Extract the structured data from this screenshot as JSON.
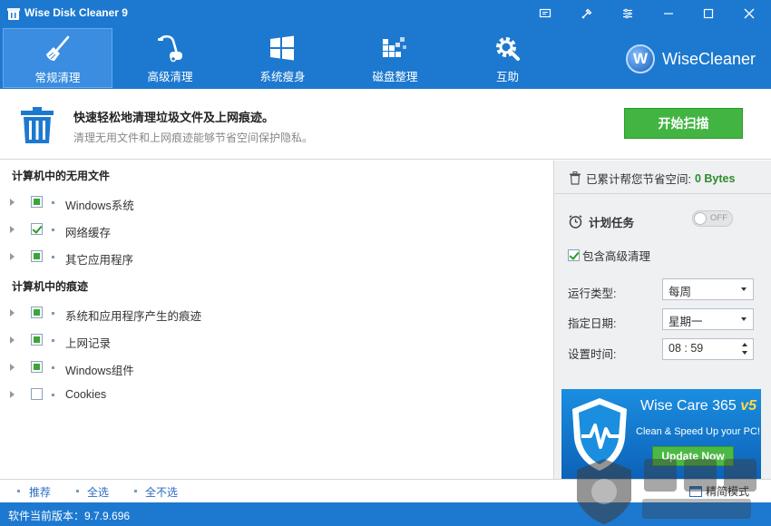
{
  "app": {
    "title": "Wise Disk Cleaner 9"
  },
  "window_controls": [
    "message-icon",
    "skin-icon",
    "menu-icon",
    "minimize-icon",
    "maximize-icon",
    "close-icon"
  ],
  "nav": {
    "items": [
      {
        "label": "常规清理",
        "icon": "broom-icon",
        "active": true
      },
      {
        "label": "高级清理",
        "icon": "vacuum-icon",
        "active": false
      },
      {
        "label": "系统瘦身",
        "icon": "windows-icon",
        "active": false
      },
      {
        "label": "磁盘整理",
        "icon": "defrag-icon",
        "active": false
      },
      {
        "label": "互助",
        "icon": "gear-wrench-icon",
        "active": false
      }
    ],
    "brand": "WiseCleaner",
    "brand_letter": "W"
  },
  "info": {
    "title": "快速轻松地清理垃圾文件及上网痕迹。",
    "subtitle": "清理无用文件和上网痕迹能够节省空间保护隐私。",
    "scan_button": "开始扫描"
  },
  "groups": [
    {
      "title": "计算机中的无用文件",
      "items": [
        {
          "label": "Windows系统",
          "state": "partial"
        },
        {
          "label": "网络缓存",
          "state": "checked"
        },
        {
          "label": "其它应用程序",
          "state": "partial"
        }
      ]
    },
    {
      "title": "计算机中的痕迹",
      "items": [
        {
          "label": "系统和应用程序产生的痕迹",
          "state": "partial"
        },
        {
          "label": "上网记录",
          "state": "partial"
        },
        {
          "label": "Windows组件",
          "state": "partial"
        },
        {
          "label": "Cookies",
          "state": "unchecked"
        }
      ]
    }
  ],
  "footer": {
    "recommend": "推荐",
    "select_all": "全选",
    "select_none": "全不选",
    "mode": "精简模式"
  },
  "right": {
    "saved_label": "已累计帮您节省空间:",
    "saved_value": "0 Bytes",
    "schedule_label": "计划任务",
    "toggle_text": "OFF",
    "include_advanced": "包含高级清理",
    "run_type_label": "运行类型:",
    "run_type_value": "每周",
    "date_label": "指定日期:",
    "date_value": "星期一",
    "time_label": "设置时间:",
    "time_value": "08 : 59"
  },
  "ad": {
    "title": "Wise Care 365",
    "version": "v5",
    "subtitle": "Clean & Speed Up your PC!",
    "button": "Update Now"
  },
  "status": {
    "version": "软件当前版本：9.7.9.696"
  },
  "colors": {
    "brand_blue": "#1d79d0",
    "scan_green": "#42b442",
    "saved_green": "#2e8b2e"
  }
}
